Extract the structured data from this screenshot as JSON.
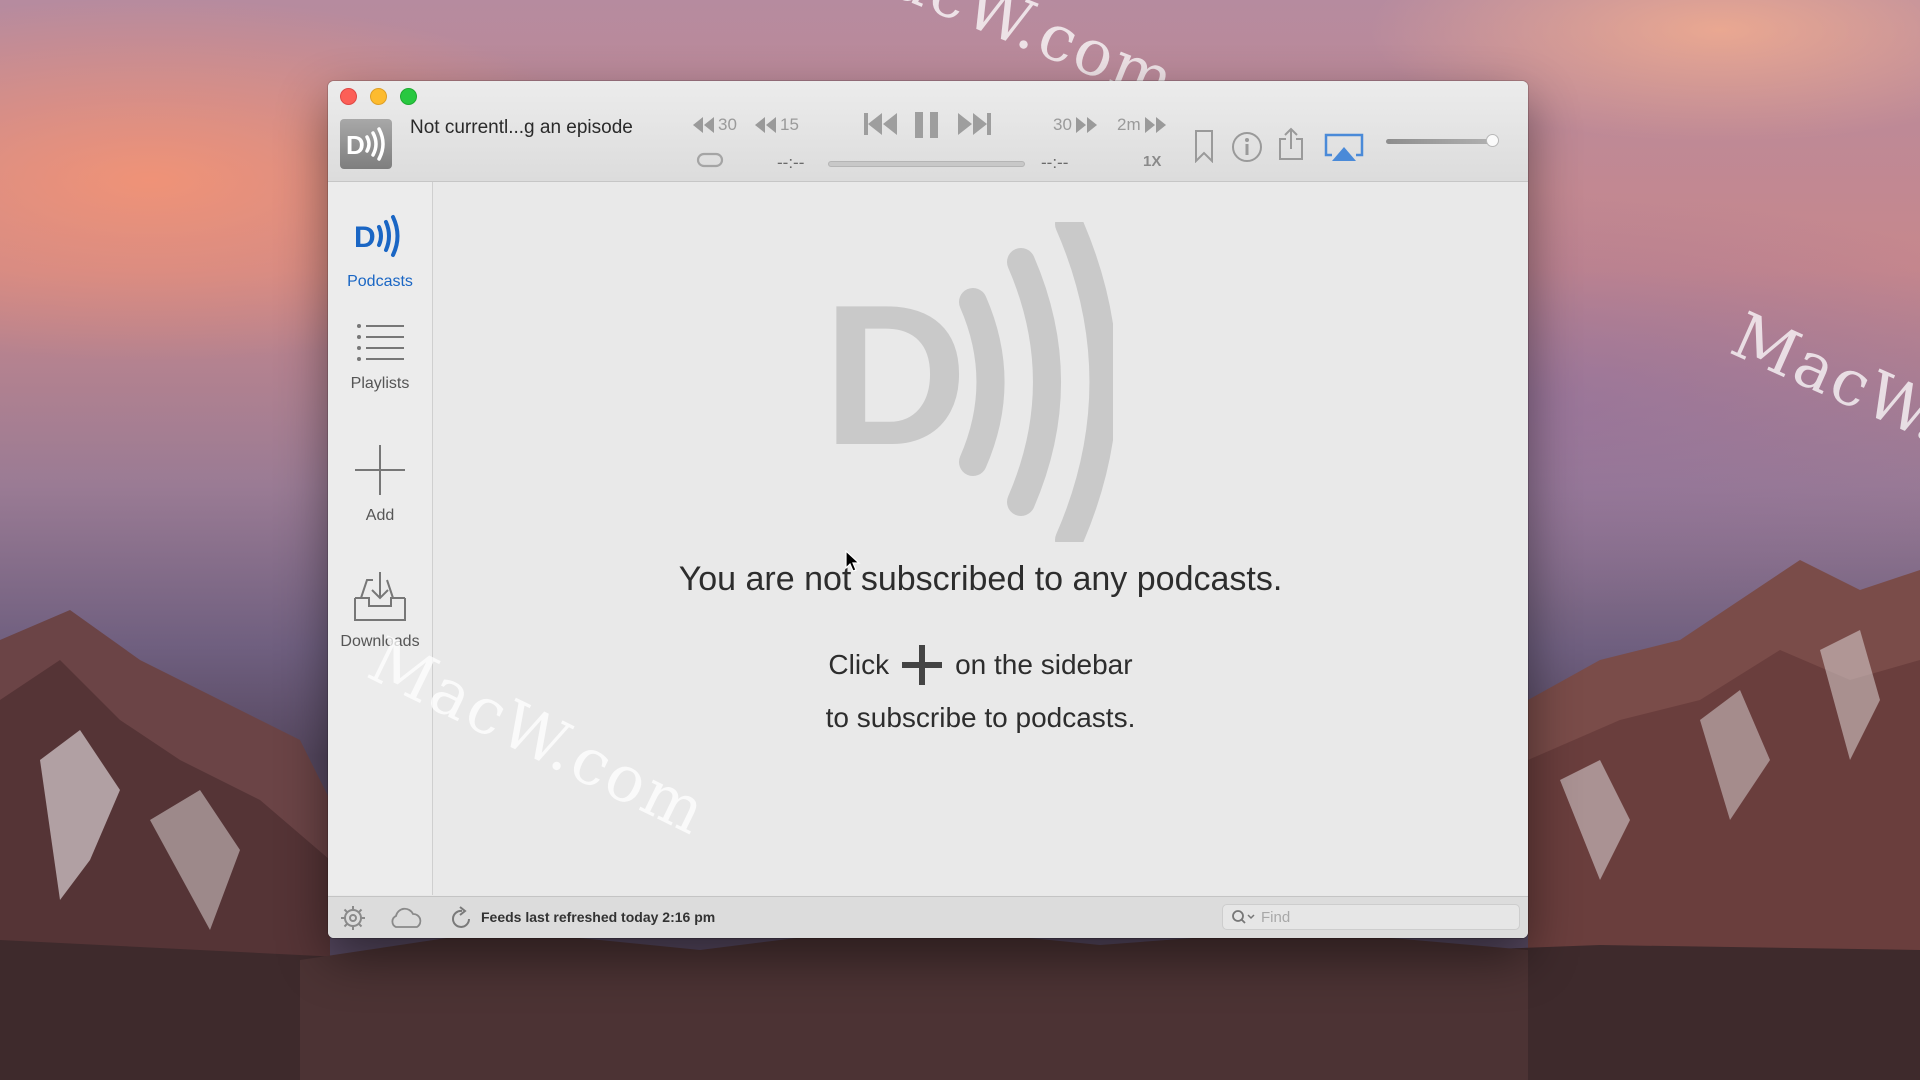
{
  "player": {
    "episode_title": "Not currentl...g an episode",
    "skip_back_30": "30",
    "skip_back_15": "15",
    "skip_fwd_30": "30",
    "skip_fwd_2m": "2m",
    "elapsed": "--:--",
    "remaining": "--:--",
    "speed": "1X",
    "progress": 0,
    "volume": 0.95
  },
  "sidebar": {
    "items": [
      {
        "label": "Podcasts",
        "icon": "podcasts-logo-icon",
        "active": true
      },
      {
        "label": "Playlists",
        "icon": "list-icon",
        "active": false
      },
      {
        "label": "Add",
        "icon": "plus-icon",
        "active": false
      },
      {
        "label": "Downloads",
        "icon": "download-tray-icon",
        "active": false
      }
    ]
  },
  "empty_state": {
    "headline": "You are not subscribed to any podcasts.",
    "line1_prefix": "Click",
    "line1_suffix": "on the sidebar",
    "line2": "to subscribe to podcasts."
  },
  "statusbar": {
    "refresh_text": "Feeds last refreshed today 2:16 pm",
    "find_placeholder": "Find"
  },
  "watermark": "MacW.com",
  "colors": {
    "accent": "#1a66c4",
    "airplay": "#4a8ad8",
    "close": "#fc5f57",
    "minimize": "#fdbb2e",
    "maximize": "#28c840"
  }
}
